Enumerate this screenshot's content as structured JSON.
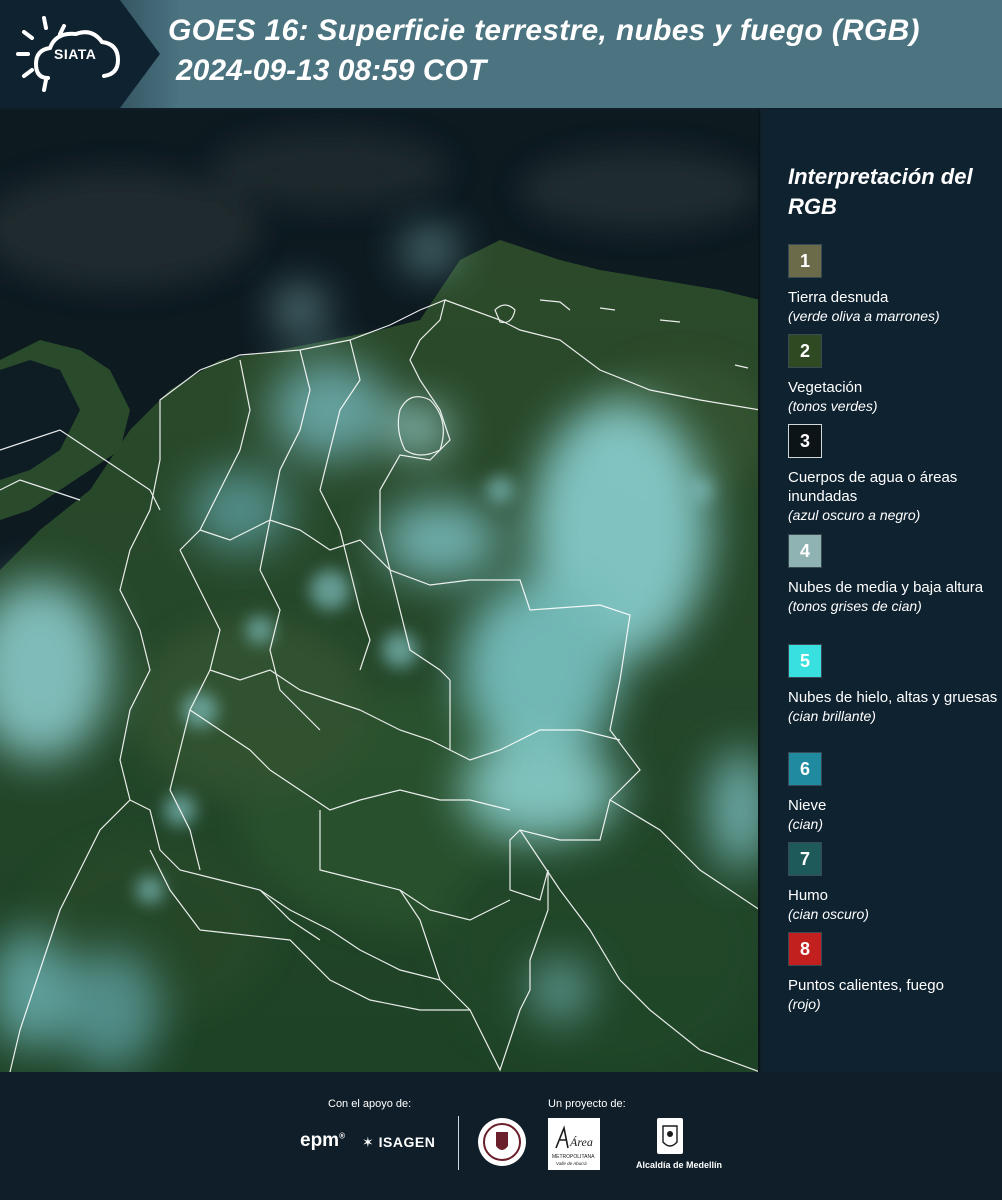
{
  "header": {
    "title": "GOES 16: Superficie terrestre, nubes y fuego (RGB)",
    "datetime": "2024-09-13 08:59 COT",
    "logo_text": "SIATA"
  },
  "legend": {
    "title": "Interpretación del RGB",
    "items": [
      {
        "number": "1",
        "label": "Tierra desnuda",
        "sub": "(verde oliva a marrones)",
        "color": "#6b6b4a"
      },
      {
        "number": "2",
        "label": "Vegetación",
        "sub": "(tonos verdes)",
        "color": "#2f4a22"
      },
      {
        "number": "3",
        "label": "Cuerpos de agua o áreas inundadas",
        "sub": "(azul oscuro a negro)",
        "color": "#0c1418"
      },
      {
        "number": "4",
        "label": "Nubes de media y baja altura",
        "sub": "(tonos grises de cian)",
        "color": "#8fb3b3"
      },
      {
        "number": "5",
        "label": "Nubes de hielo, altas y gruesas",
        "sub": "(cian brillante)",
        "color": "#38e0e0"
      },
      {
        "number": "6",
        "label": "Nieve",
        "sub": "(cian)",
        "color": "#1f8aa0"
      },
      {
        "number": "7",
        "label": "Humo",
        "sub": "(cian oscuro)",
        "color": "#1f5a5a"
      },
      {
        "number": "8",
        "label": "Puntos calientes, fuego",
        "sub": "(rojo)",
        "color": "#c21f1f"
      }
    ]
  },
  "footer": {
    "support_label": "Con el apoyo de:",
    "project_label": "Un proyecto de:",
    "epm": "epm",
    "isagen": "ISAGEN",
    "area_name": "Área",
    "area_sub": "METROPOLITANA",
    "area_sub2": "Valle de Aburrá",
    "alcaldia": "Alcaldía de Medellín"
  }
}
